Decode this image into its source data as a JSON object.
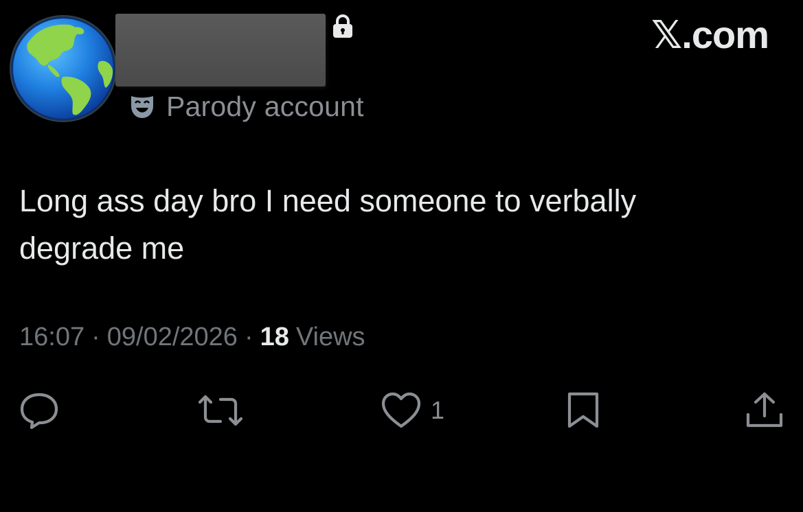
{
  "header": {
    "avatar_icon": "globe-americas-icon",
    "lock_icon": "lock-icon",
    "badge_icon": "theater-mask-icon",
    "badge_label": "Parody account",
    "brand": "𝕏.com"
  },
  "post": {
    "text": "Long ass day bro I need someone to verbally degrade me",
    "time": "16:07",
    "separator": "·",
    "date": "09/02/2026",
    "views_count": "18",
    "views_label": "Views"
  },
  "actions": {
    "reply_icon": "reply-icon",
    "repost_icon": "repost-icon",
    "like_icon": "heart-icon",
    "like_count": "1",
    "bookmark_icon": "bookmark-icon",
    "share_icon": "share-icon"
  },
  "colors": {
    "background": "#000000",
    "primary_text": "#e7e9ea",
    "secondary_text": "#71767b",
    "redaction": "#555555"
  }
}
